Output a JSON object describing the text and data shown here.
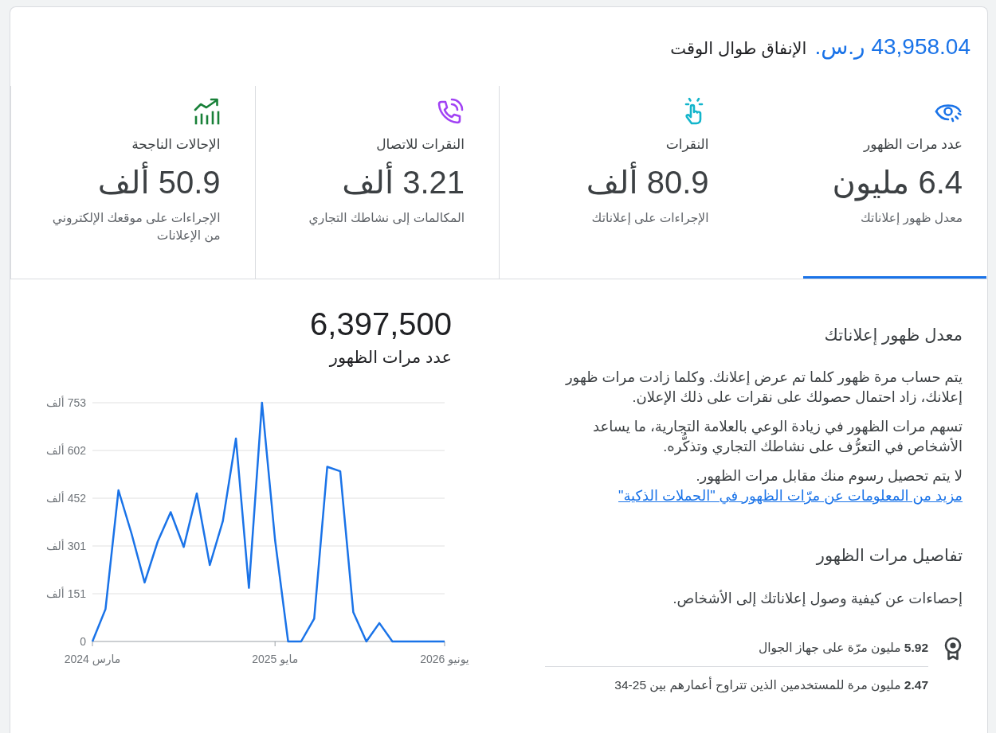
{
  "spend": {
    "amount": "43,958.04 ر.س.",
    "label": "الإنفاق طوال الوقت"
  },
  "metrics": [
    {
      "label": "عدد مرات الظهور",
      "value": "6.4 مليون",
      "description": "معدل ظهور إعلاناتك",
      "selected": true,
      "color": "#1a73e8"
    },
    {
      "label": "النقرات",
      "value": "80.9 ألف",
      "description": "الإجراءات على إعلاناتك",
      "selected": false,
      "color": "#12b5cb"
    },
    {
      "label": "النقرات للاتصال",
      "value": "3.21 ألف",
      "description": "المكالمات إلى نشاطك التجاري",
      "selected": false,
      "color": "#a142f4"
    },
    {
      "label": "الإحالات الناجحة",
      "value": "50.9 ألف",
      "description": "الإجراءات على موقعك الإلكتروني من الإعلانات",
      "selected": false,
      "color": "#188038"
    }
  ],
  "detail": {
    "info": {
      "title": "معدل ظهور إعلاناتك",
      "paragraphs": [
        {
          "text": "يتم حساب مرة ظهور كلما تم عرض إعلانك. وكلما زادت مرات ظهور إعلانك، زاد احتمال حصولك على نقرات على ذلك الإعلان."
        },
        {
          "text": "تسهم مرات الظهور في زيادة الوعي بالعلامة التجارية، ما يساعد الأشخاص في التعرُّف على نشاطك التجاري وتذكُّره."
        },
        {
          "text": "لا يتم تحصيل رسوم منك مقابل مرات الظهور.",
          "link": "مزيد من المعلومات عن مرّات الظهور في \"الحملات الذكية\""
        }
      ],
      "breakdown_title": "تفاصيل مرات الظهور",
      "breakdown_text": "إحصاءات عن كيفية وصول إعلاناتك إلى الأشخاص.",
      "breakdown": [
        {
          "kind": "award",
          "text": "**5.92** مليون مرّة على جهاز الجوال"
        },
        {
          "kind": "plain",
          "text": "**2.47** مليون مرة للمستخدمين الذين تتراوح أعمارهم بين 25-34"
        }
      ]
    },
    "chart": {
      "total": "6,397,500",
      "chart_data": {
        "type": "line",
        "title": "عدد مرات الظهور",
        "categories": [
          "مارس 2024",
          null,
          null,
          null,
          null,
          null,
          null,
          null,
          null,
          null,
          null,
          null,
          null,
          null,
          "مايو 2025",
          null,
          null,
          null,
          null,
          null,
          null,
          null,
          null,
          null,
          null,
          null,
          null,
          "يونيو 2026"
        ],
        "series": [
          {
            "color": "#1a73e8",
            "values": [
              0,
              102,
              477,
              340,
              186,
              315,
              408,
              298,
              467,
              241,
              380,
              640,
              169,
              753,
              320,
              0,
              0,
              72,
              551,
              537,
              92,
              0,
              58,
              0,
              0,
              0,
              0,
              0
            ]
          }
        ],
        "ylim": [
          0,
          753
        ],
        "yticks": [
          {
            "value": 0,
            "label": "0"
          },
          {
            "value": 150.6,
            "label": "151 ألف"
          },
          {
            "value": 301.2,
            "label": "301 ألف"
          },
          {
            "value": 451.8,
            "label": "452 ألف"
          },
          {
            "value": 602.4,
            "label": "602 ألف"
          },
          {
            "value": 753,
            "label": "753 ألف"
          }
        ],
        "grid": true
      }
    }
  }
}
